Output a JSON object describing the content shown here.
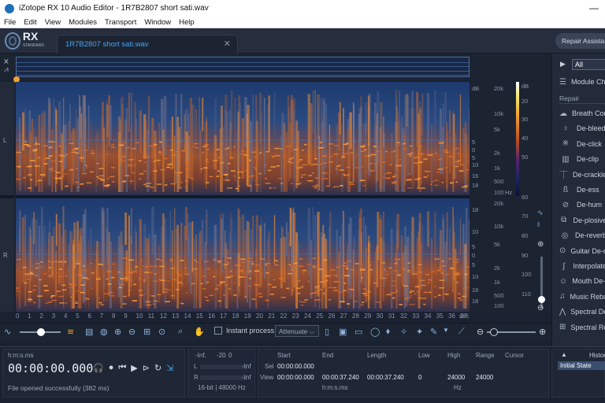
{
  "window": {
    "title": "iZotope RX 10 Audio Editor - 1R7B2807 short sati.wav"
  },
  "menu": [
    "File",
    "Edit",
    "View",
    "Modules",
    "Transport",
    "Window",
    "Help"
  ],
  "logo": {
    "name": "RX",
    "edition": "STANDARD"
  },
  "file_tab": {
    "name": "1R7B2807 short sati.wav"
  },
  "repair_assistant": "Repair Assistant",
  "spectrogram": {
    "channel_labels": [
      "L",
      "R"
    ],
    "db_header": "dB",
    "hz_header": "Hz",
    "db_ticks_left": [
      "5",
      "0",
      "5",
      "10",
      "16",
      "18"
    ],
    "db_ticks_left_right": [
      "18",
      "10",
      "5",
      "0",
      "5",
      "10",
      "16",
      "18"
    ],
    "freq_ticks": [
      "20k",
      "10k",
      "5k",
      "2k",
      "1k",
      "500",
      "100"
    ],
    "color_db_ticks": [
      "dB",
      "20",
      "30",
      "40",
      "50",
      "60",
      "70",
      "80",
      "90",
      "100",
      "110"
    ],
    "time_ticks": [
      "0",
      "1",
      "2",
      "3",
      "4",
      "5",
      "6",
      "7",
      "8",
      "9",
      "10",
      "11",
      "12",
      "13",
      "14",
      "15",
      "16",
      "17",
      "18",
      "19",
      "20",
      "21",
      "22",
      "23",
      "24",
      "25",
      "26",
      "27",
      "28",
      "29",
      "30",
      "31",
      "32",
      "33",
      "34",
      "35",
      "36",
      "37"
    ],
    "time_unit": "sec"
  },
  "toolbar": {
    "instant_process": "Instant process",
    "attenuate": "Attenuate"
  },
  "side_panel": {
    "filter": "All",
    "module_chain": "Module Chain",
    "category": "Repair",
    "modules": [
      "Breath Control",
      "De-bleed",
      "De-click",
      "De-clip",
      "De-crackle",
      "De-ess",
      "De-hum",
      "De-plosive",
      "De-reverb",
      "Guitar De-noise",
      "Interpolate",
      "Mouth De-click",
      "Music Rebalance",
      "Spectral De-noise",
      "Spectral Repair"
    ]
  },
  "bottom": {
    "time_format": "h:m:s.ms",
    "current_time": "00:00:00.000",
    "status": "File opened successfully (382 ms)",
    "meter": {
      "labels": [
        "-Inf.",
        "-20",
        "0"
      ],
      "channels": [
        "L",
        "R"
      ],
      "inf": "-Inf",
      "format": "16-bit | 48000 Hz"
    },
    "selection": {
      "headers": [
        "Start",
        "End",
        "Length",
        "Low",
        "High",
        "Range",
        "Cursor"
      ],
      "sel_label": "Sel",
      "view_label": "View",
      "sel_start": "00:00:00.000",
      "view_start": "00:00:00.000",
      "view_end": "00:00:37.240",
      "view_length": "00:00:37.240",
      "low": "0",
      "high": "24000",
      "range": "24000",
      "time_unit": "h:m:s.ms",
      "freq_unit": "Hz"
    },
    "history": {
      "title": "History",
      "initial": "Initial State"
    }
  }
}
